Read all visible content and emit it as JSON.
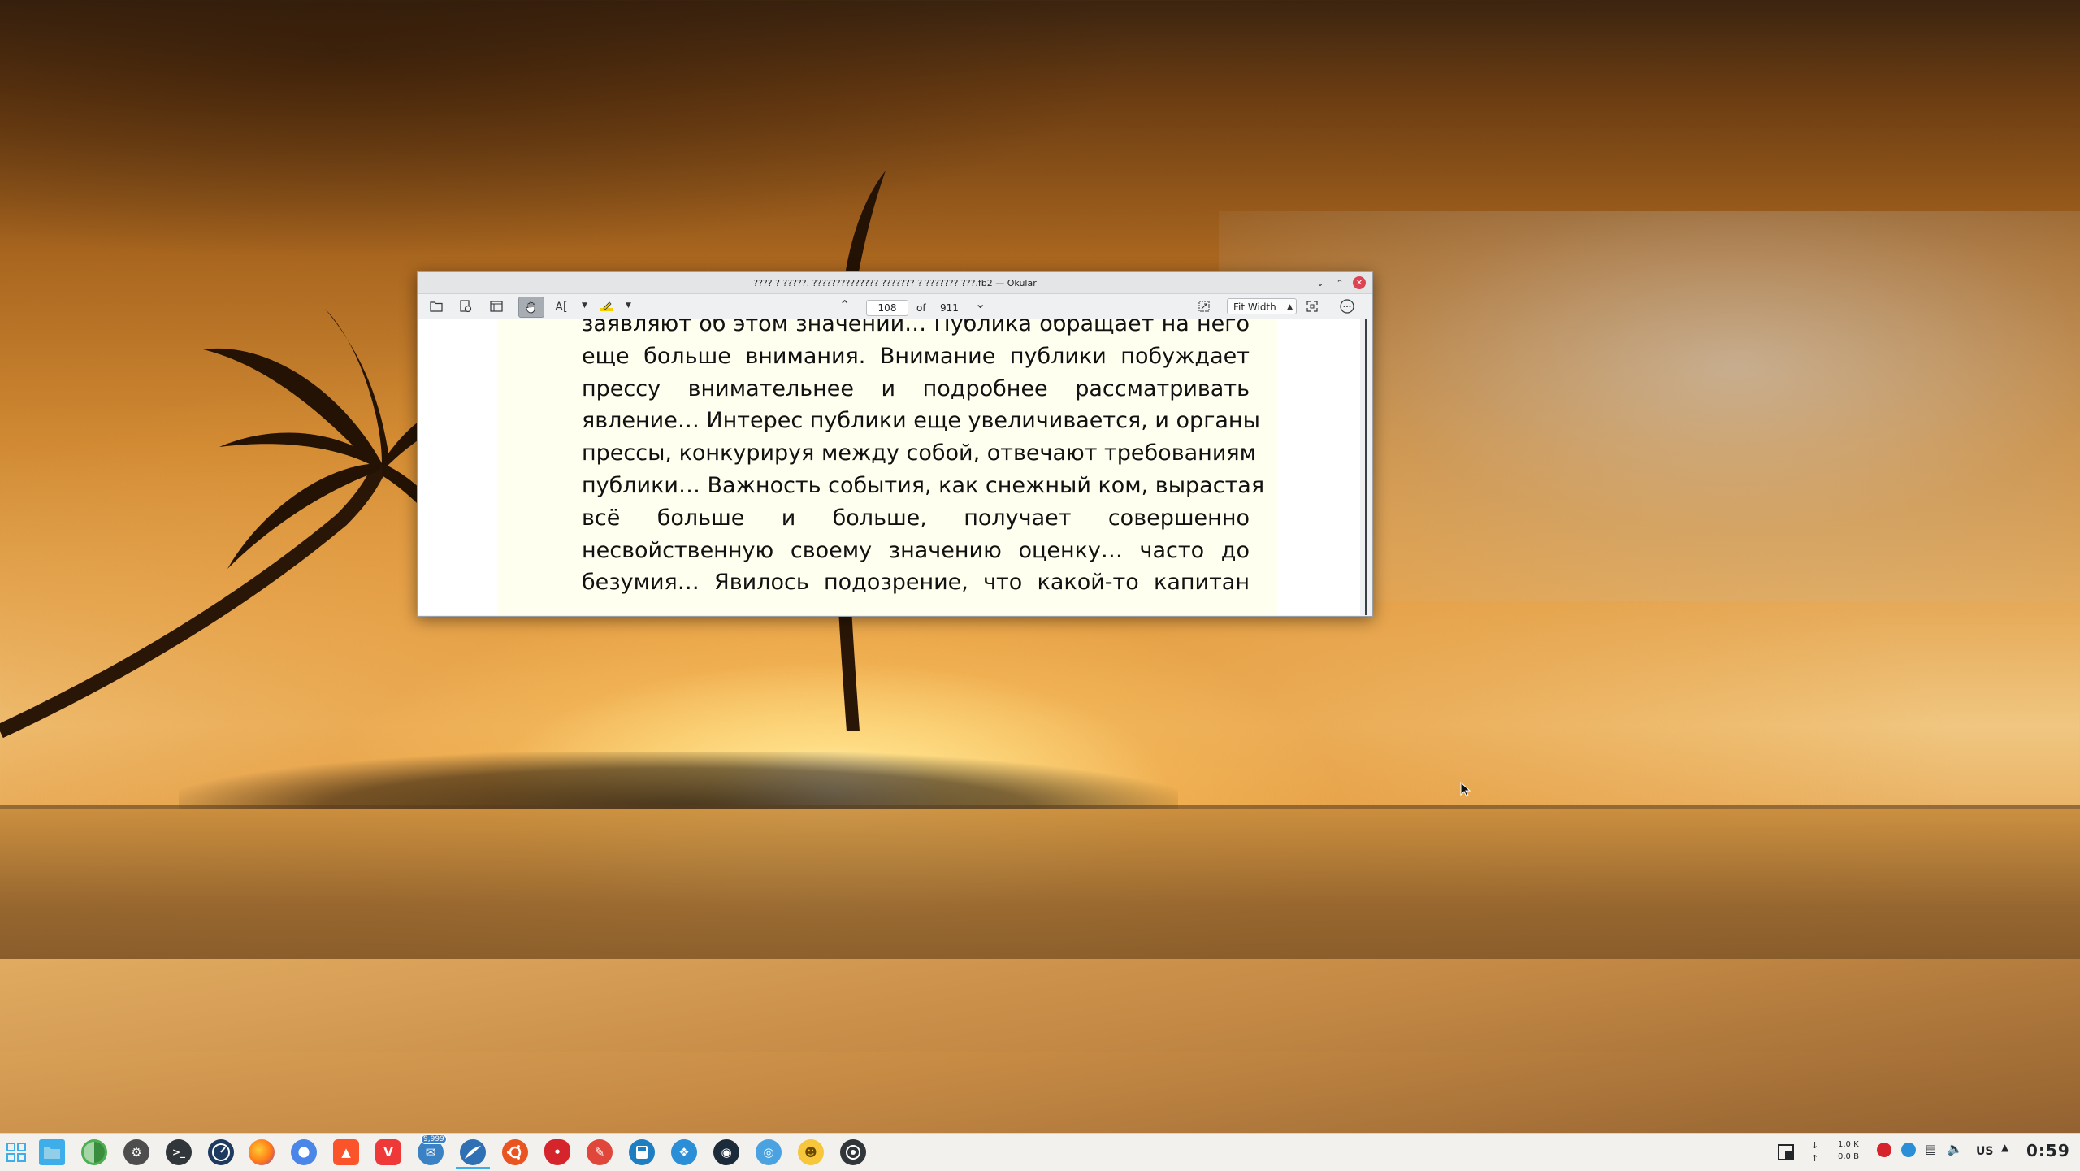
{
  "window": {
    "title": "???? ? ?????. ?????????????? ??????? ? ??????? ???.fb2 — Okular",
    "minimize_icon": "chevron-down-icon",
    "maximize_icon": "chevron-up-icon",
    "close_icon": "close-icon"
  },
  "toolbar": {
    "buttons": [
      {
        "name": "open-button",
        "icon": "folder-icon"
      },
      {
        "name": "open-recent-button",
        "icon": "document-reload-icon"
      },
      {
        "name": "sidebar-toggle-button",
        "icon": "panel-icon"
      },
      {
        "name": "browse-tool-button",
        "icon": "hand-icon",
        "active": true
      },
      {
        "name": "text-select-tool-button",
        "icon": "text-select-icon"
      },
      {
        "name": "annotation-button",
        "icon": "highlighter-icon"
      }
    ],
    "page_current": "108",
    "of_label": "of",
    "page_total": "911",
    "zoom": "Fit Width",
    "right_buttons": [
      {
        "name": "fit-page-button",
        "icon": "fit-icon"
      },
      {
        "name": "fullscreen-button",
        "icon": "fullscreen-icon"
      },
      {
        "name": "more-button",
        "icon": "more-icon"
      }
    ]
  },
  "document": {
    "lines": [
      "заявляют об этом значении… Публика обращает на него",
      "еще больше внимания. Внимание публики побуждает",
      "прессу внимательнее и подробнее рассматривать",
      "явление… Интерес публики еще увеличивается, и органы",
      "прессы, конкурируя между собой, отвечают требованиям",
      "публики… Важность события, как снежный ком, вырастая",
      "всё больше и больше, получает совершенно",
      "несвойственную своему значению оценку… часто до",
      "безумия… Явилось подозрение, что какой-то капитан"
    ]
  },
  "taskbar": {
    "apps": [
      {
        "name": "app-launcher",
        "icon": "grid-icon",
        "color": "#3daee9"
      },
      {
        "name": "file-manager",
        "icon": "folder-icon",
        "color": "#3daee9"
      },
      {
        "name": "disk-usage",
        "icon": "pie-icon",
        "color": "#4caf50"
      },
      {
        "name": "system-settings",
        "icon": "gear-icon",
        "color": "#4d4d4d"
      },
      {
        "name": "terminal",
        "icon": "terminal-icon",
        "color": "#31363b"
      },
      {
        "name": "system-monitor",
        "icon": "gauge-icon",
        "color": "#1e3a5f"
      },
      {
        "name": "firefox",
        "icon": "firefox-icon",
        "color": "#ff7a18"
      },
      {
        "name": "chromium",
        "icon": "chromium-icon",
        "color": "#4a86e8"
      },
      {
        "name": "brave",
        "icon": "lion-icon",
        "color": "#fb542b"
      },
      {
        "name": "vivaldi",
        "icon": "vivaldi-icon",
        "color": "#ef3939"
      },
      {
        "name": "mail-client",
        "icon": "mail-icon",
        "color": "#3b82c4",
        "badge": "9,999"
      },
      {
        "name": "okular",
        "icon": "okular-icon",
        "color": "#2f6fb3",
        "active": true
      },
      {
        "name": "ubuntu-app",
        "icon": "ubuntu-icon",
        "color": "#e95420"
      },
      {
        "name": "strawberry",
        "icon": "strawberry-icon",
        "color": "#d6242c"
      },
      {
        "name": "text-editor",
        "icon": "pencil-icon",
        "color": "#e0463a"
      },
      {
        "name": "calculator-app",
        "icon": "calc-icon",
        "color": "#1d7fc1"
      },
      {
        "name": "kde-connect",
        "icon": "swirl-icon",
        "color": "#2a8fd6"
      },
      {
        "name": "celestia",
        "icon": "globe-icon",
        "color": "#1c2b3a"
      },
      {
        "name": "settings-round",
        "icon": "settings-round-icon",
        "color": "#4aa3e0"
      },
      {
        "name": "emoji-picker",
        "icon": "smile-icon",
        "color": "#f7c63b"
      },
      {
        "name": "camera-app",
        "icon": "camera-icon",
        "color": "#31363b"
      }
    ],
    "net_down": "1.0 K",
    "net_up": "0.0 B",
    "keyboard_layout": "US",
    "clock": "0:59"
  }
}
